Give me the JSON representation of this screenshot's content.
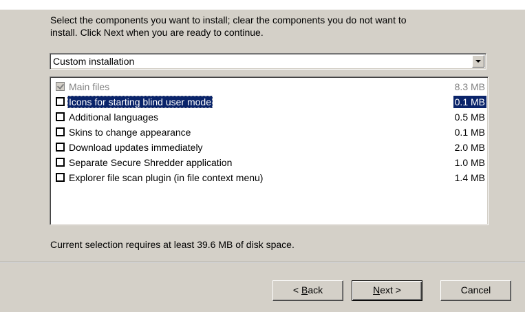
{
  "instructions": {
    "line1": "Select the components you want to install; clear the components you do not want to",
    "line2": "install. Click Next when you are ready to continue."
  },
  "install_type": {
    "selected": "Custom installation"
  },
  "components": [
    {
      "label": "Main files",
      "size": "8.3 MB",
      "checked": true,
      "disabled": true,
      "selected": false
    },
    {
      "label": "Icons for starting blind user mode",
      "size": "0.1 MB",
      "checked": false,
      "disabled": false,
      "selected": true
    },
    {
      "label": "Additional languages",
      "size": "0.5 MB",
      "checked": false,
      "disabled": false,
      "selected": false
    },
    {
      "label": "Skins to change appearance",
      "size": "0.1 MB",
      "checked": false,
      "disabled": false,
      "selected": false
    },
    {
      "label": "Download updates immediately",
      "size": "2.0 MB",
      "checked": false,
      "disabled": false,
      "selected": false
    },
    {
      "label": "Separate Secure Shredder application",
      "size": "1.0 MB",
      "checked": false,
      "disabled": false,
      "selected": false
    },
    {
      "label": "Explorer file scan plugin (in file context menu)",
      "size": "1.4 MB",
      "checked": false,
      "disabled": false,
      "selected": false
    }
  ],
  "status": "Current selection requires at least 39.6 MB of disk space.",
  "buttons": {
    "back_prefix": "< ",
    "back_key": "B",
    "back_rest": "ack",
    "next_key": "N",
    "next_rest": "ext >",
    "cancel": "Cancel"
  },
  "colors": {
    "selection": "#0a246a",
    "dialog_bg": "#d4d0c8"
  }
}
